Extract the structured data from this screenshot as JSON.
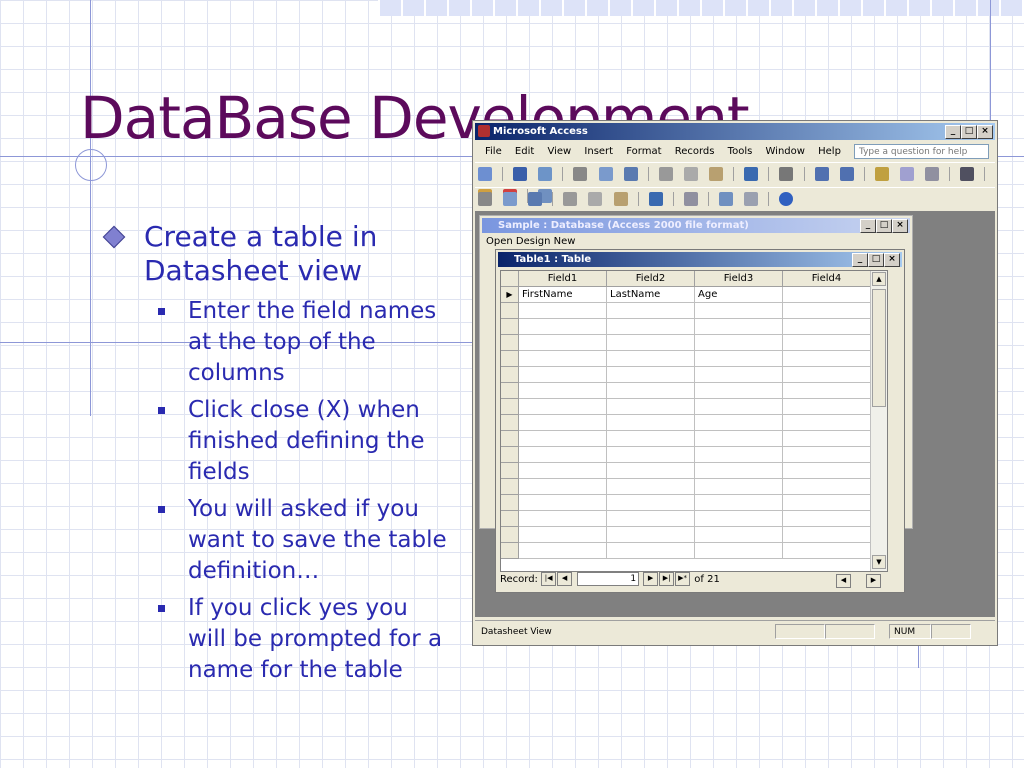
{
  "slide": {
    "title": "DataBase Development",
    "bullets": [
      {
        "text": "Create a table in Datasheet view",
        "sub": [
          "Enter the field names at the top of the columns",
          "Click close (X) when finished defining the fields",
          "You will asked if you want to save the table definition…",
          "If you click yes you will be prompted for a name for the table"
        ]
      }
    ]
  },
  "access": {
    "title": "Microsoft Access",
    "menu": [
      "File",
      "Edit",
      "View",
      "Insert",
      "Format",
      "Records",
      "Tools",
      "Window",
      "Help"
    ],
    "help_placeholder": "Type a question for help",
    "status_left": "Datasheet View",
    "status_num": "NUM",
    "controls": {
      "minimize": "_",
      "maximize": "□",
      "close": "×"
    }
  },
  "db_window": {
    "title": "Sample : Database (Access 2000 file format)",
    "toolbar": "Open  Design  New"
  },
  "table_window": {
    "title": "Table1 : Table",
    "columns": [
      "Field1",
      "Field2",
      "Field3",
      "Field4"
    ],
    "first_row": [
      "FirstName",
      "LastName",
      "Age",
      ""
    ],
    "record_label": "Record:",
    "record_current": "1",
    "record_of": "of  21"
  },
  "colors": {
    "title": "#5c0a5c",
    "bullet": "#2a2ab0",
    "grid": "#dfe3f1"
  }
}
